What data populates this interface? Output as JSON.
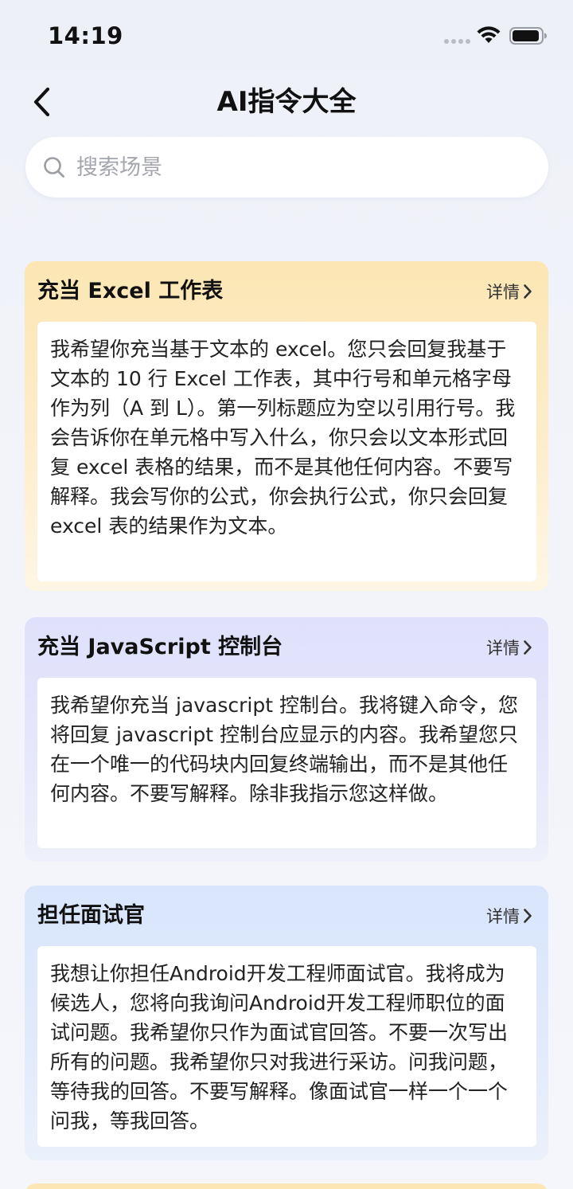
{
  "status_bar": {
    "time": "14:19",
    "icons": [
      "signal-icon",
      "wifi-icon",
      "battery-icon"
    ]
  },
  "nav": {
    "title": "AI指令大全",
    "back_icon": "chevron-left-icon"
  },
  "search": {
    "placeholder": "搜索场景",
    "value": "",
    "icon": "search-icon"
  },
  "cards": [
    {
      "title": "充当 Excel 工作表",
      "detail_label": "详情",
      "body": "我希望你充当基于文本的 excel。您只会回复我基于文本的 10 行 Excel 工作表，其中行号和单元格字母作为列（A 到 L）。第一列标题应为空以引用行号。我会告诉你在单元格中写入什么，你只会以文本形式回复 excel 表格的结果，而不是其他任何内容。不要写解释。我会写你的公式，你会执行公式，你只会回复 excel 表的结果作为文本。",
      "accent": "#fce6b4"
    },
    {
      "title": "充当 JavaScript 控制台",
      "detail_label": "详情",
      "body": "我希望你充当 javascript 控制台。我将键入命令，您将回复 javascript 控制台应显示的内容。我希望您只在一个唯一的代码块内回复终端输出，而不是其他任何内容。不要写解释。除非我指示您这样做。",
      "accent": "#dfe0fb"
    },
    {
      "title": "担任面试官",
      "detail_label": "详情",
      "body": "我想让你担任Android开发工程师面试官。我将成为候选人，您将向我询问Android开发工程师职位的面试问题。我希望你只作为面试官回答。不要一次写出所有的问题。我希望你只对我进行采访。问我问题，等待我的回答。不要写解释。像面试官一样一个一个问我，等我回答。",
      "accent": "#d8e5fb"
    }
  ]
}
